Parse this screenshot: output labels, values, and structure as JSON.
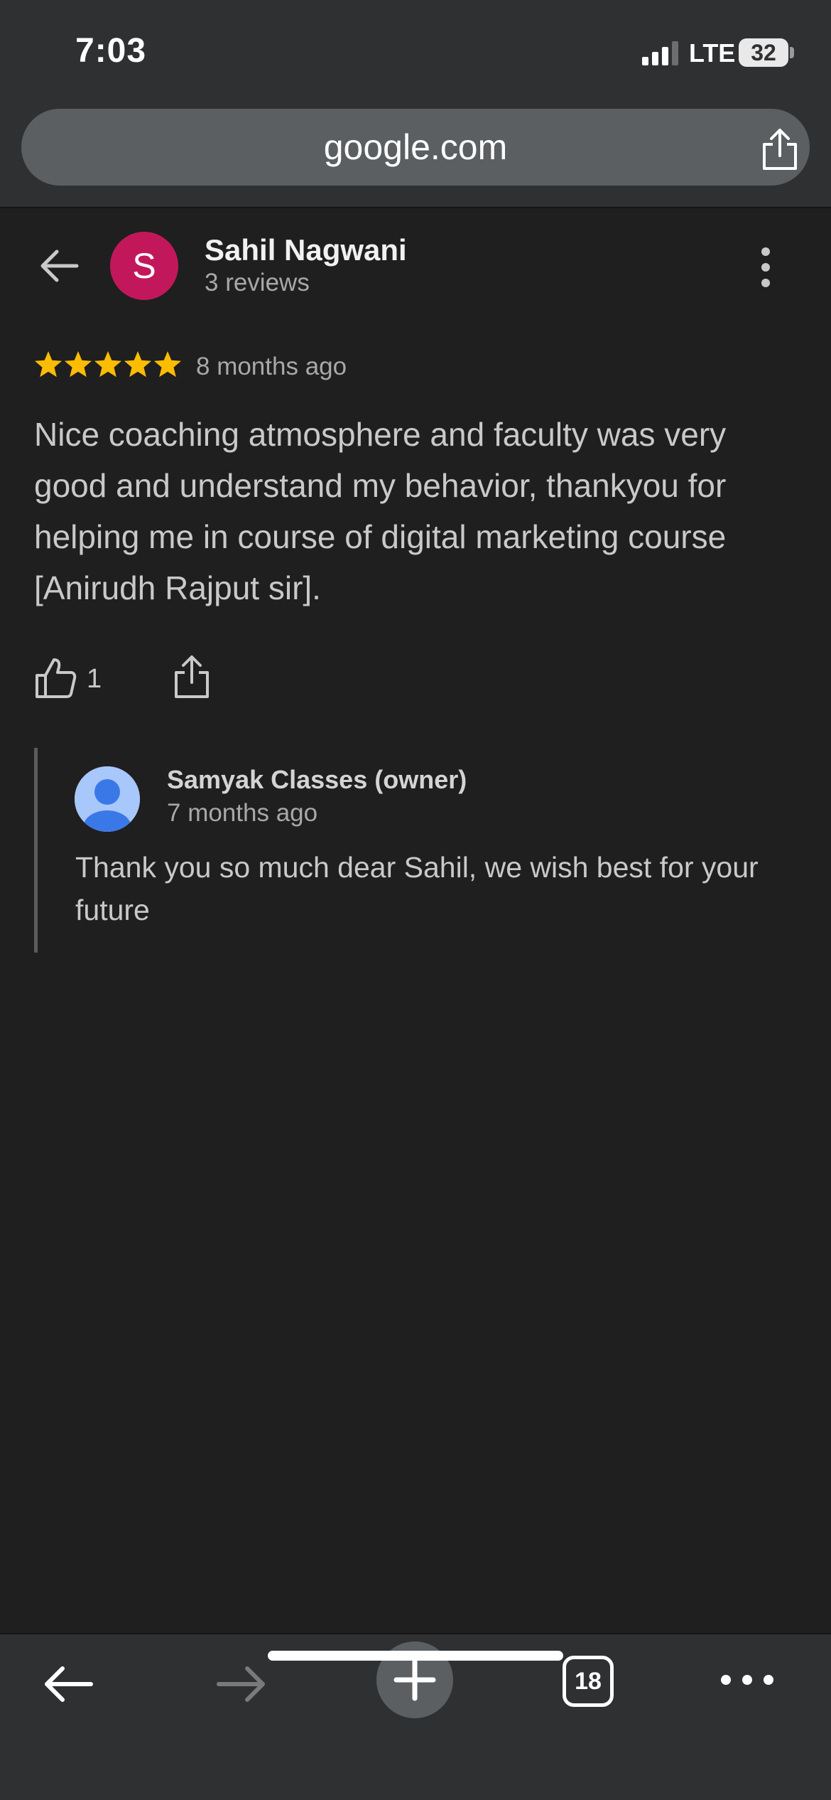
{
  "status_bar": {
    "time": "7:03",
    "network": "LTE",
    "battery": "32"
  },
  "browser": {
    "url": "google.com",
    "tab_count": "18"
  },
  "review": {
    "reviewer_name": "Sahil Nagwani",
    "reviewer_avatar_letter": "S",
    "reviewer_meta": "3 reviews",
    "rating": 5,
    "time": "8 months ago",
    "text": "Nice coaching atmosphere and faculty was very good and understand my behavior, thankyou for helping me in course of digital marketing course [Anirudh Rajput sir].",
    "likes": "1"
  },
  "owner_reply": {
    "name": "Samyak Classes (owner)",
    "time": "7 months ago",
    "text": "Thank you so much dear Sahil, we wish best for your future"
  },
  "colors": {
    "avatar": "#c2185b",
    "star": "#fbbc04",
    "background": "#1f1f1f",
    "chrome": "#2f3032"
  }
}
